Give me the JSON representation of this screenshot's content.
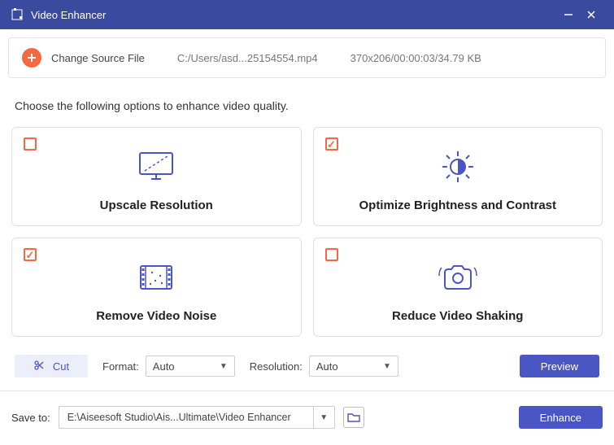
{
  "titlebar": {
    "title": "Video Enhancer"
  },
  "source": {
    "change_label": "Change Source File",
    "path": "C:/Users/asd...25154554.mp4",
    "meta": "370x206/00:00:03/34.79 KB"
  },
  "instruction": "Choose the following options to enhance video quality.",
  "cards": {
    "upscale": {
      "label": "Upscale Resolution",
      "checked": false
    },
    "brightness": {
      "label": "Optimize Brightness and Contrast",
      "checked": true
    },
    "noise": {
      "label": "Remove Video Noise",
      "checked": true
    },
    "shaking": {
      "label": "Reduce Video Shaking",
      "checked": false
    }
  },
  "controls": {
    "cut": "Cut",
    "format_label": "Format:",
    "format_value": "Auto",
    "resolution_label": "Resolution:",
    "resolution_value": "Auto",
    "preview": "Preview"
  },
  "footer": {
    "save_to_label": "Save to:",
    "path": "E:\\Aiseesoft Studio\\Ais...Ultimate\\Video Enhancer",
    "enhance": "Enhance"
  }
}
